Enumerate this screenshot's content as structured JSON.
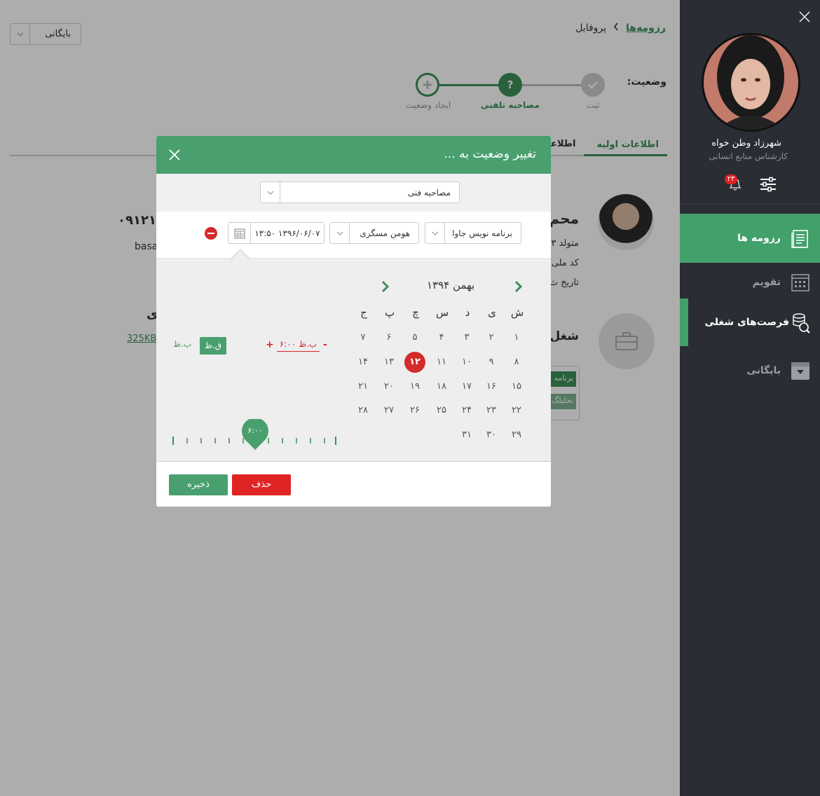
{
  "page": {
    "archive_select": "بایگانی",
    "breadcrumb": {
      "link": "رزومه‌ها",
      "separator": ">",
      "current": "پروفایل"
    },
    "status_label": "وضعیت:",
    "steps": [
      {
        "label": "ثبت",
        "icon": "check-icon"
      },
      {
        "label": "مصاحبه تلفنی",
        "icon": "question-icon"
      },
      {
        "label": "ایجاد وضعیت",
        "icon": "plus-icon"
      }
    ],
    "tabs": [
      "اطلاعات اولیه",
      "اطلاعات ت"
    ],
    "profile": {
      "name": "محم",
      "phone": "۰۹۱۲۱۳",
      "email_partial": "basa",
      "line1": "متولد ۳",
      "line2": "کد ملی",
      "line3": "تاریخ ث"
    },
    "jobs": {
      "title": "شغل‌ه",
      "left_heading": "ی",
      "file_size": "325KB",
      "tags": [
        "برنامه",
        "تحلیلگ"
      ]
    }
  },
  "sidebar": {
    "user_name": "شهرزاد  وطن خواه",
    "user_role": "کارشناس منابع انسانی",
    "notification_count": "۲۳",
    "items": [
      {
        "label": "رزومه ها",
        "icon": "document-icon",
        "state": "active"
      },
      {
        "label": "تقویم",
        "icon": "calendar-icon",
        "state": "normal"
      },
      {
        "label": "فرصت‌های شغلی",
        "icon": "job-search-icon",
        "state": "hover"
      },
      {
        "label": "بایگانی",
        "icon": "archive-icon",
        "state": "normal"
      }
    ]
  },
  "modal": {
    "title": "تغییر وضعیت به ...",
    "status_select": "مصاحبه فنی",
    "job_select": "برنامه نویس جاوا",
    "interviewer_select": "هومن مسگری",
    "datetime": "۱۳:۵۰ ۱۳۹۶/۰۶/۰۷",
    "calendar": {
      "month": "بهمن ۱۳۹۴",
      "weekdays": [
        "ش",
        "ی",
        "د",
        "س",
        "چ",
        "پ",
        "ج"
      ],
      "weeks": [
        [
          "۱",
          "۲",
          "۳",
          "۴",
          "۵",
          "۶",
          "۷"
        ],
        [
          "۸",
          "۹",
          "۱۰",
          "۱۱",
          "۱۲",
          "۱۳",
          "۱۴"
        ],
        [
          "۱۵",
          "۱۶",
          "۱۷",
          "۱۸",
          "۱۹",
          "۲۰",
          "۲۱"
        ],
        [
          "۲۲",
          "۲۳",
          "۲۴",
          "۲۵",
          "۲۶",
          "۲۷",
          "۲۸"
        ],
        [
          "۲۹",
          "۳۰",
          "۳۱",
          "",
          "",
          "",
          ""
        ]
      ],
      "selected_day": "۱۲"
    },
    "time": {
      "marker": "۶:۰۰",
      "value": "۶:۰۰ ب.ظ",
      "minus": "-",
      "plus": "+",
      "am": "ق.ظ",
      "pm": "ب.ظ"
    },
    "buttons": {
      "save": "ذخیره",
      "delete": "حذف"
    }
  },
  "colors": {
    "accent": "#4a9f6f",
    "danger": "#d42b2b",
    "sidebar": "#2a2d33"
  }
}
